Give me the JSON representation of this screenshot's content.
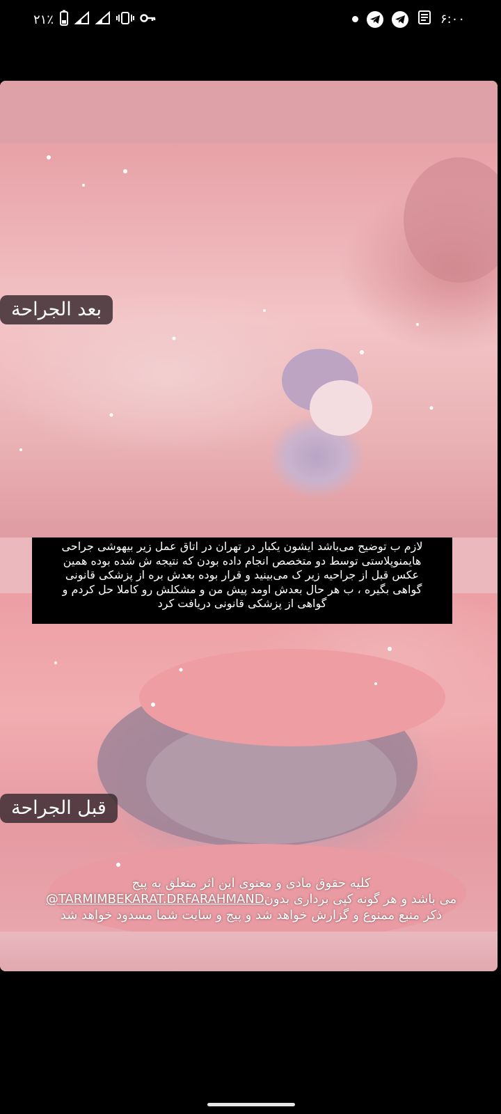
{
  "status_bar": {
    "battery_percent": "۲۱٪",
    "time": "۶:۰۰",
    "icons_left": [
      "battery-icon",
      "signal-icon",
      "signal-icon",
      "vibrate-icon",
      "vpn-key-icon"
    ],
    "icons_right": [
      "notification-dot-icon",
      "telegram-icon",
      "telegram-icon",
      "news-icon"
    ]
  },
  "story": {
    "label_after": "بعد الجراحة",
    "label_before": "قبل الجراحة",
    "caption_lines": [
      "لازم ب توضیح می‌باشد ایشون یکبار در تهران در اتاق عمل زیر بیهوشی جراحی",
      "هایمنوپلاستی توسط دو متخصص انجام داده بودن که نتیجه ش شده بوده همین",
      "عکس قبل از جراحیه زیر ک می‌بینید و قرار بوده بعدش بره از پزشکی قانونی",
      "گواهی بگیره ، ب هر حال بعدش اومد پیش من و مشکلش رو کاملا حل کردم و",
      "گواهی از پزشکی قانونی دریافت کرد"
    ],
    "copyright_line1": "کلیه حقوق مادی و معنوی این اثر متعلق به پیج",
    "copyright_handle": "@TARMIMBEKARAT.DRFARAHMAND",
    "copyright_line2_rest": " می باشد و هر گونه کپی برداری بدون",
    "copyright_line3": "ذکر منبع ممنوع و گزارش خواهد شد و پیج و سایت شما مسدود خواهد شد"
  },
  "colors": {
    "background": "#000000",
    "card_pink": "#e6a7af",
    "caption_bg": "#000000",
    "tag_bg": "#3c2d32"
  }
}
